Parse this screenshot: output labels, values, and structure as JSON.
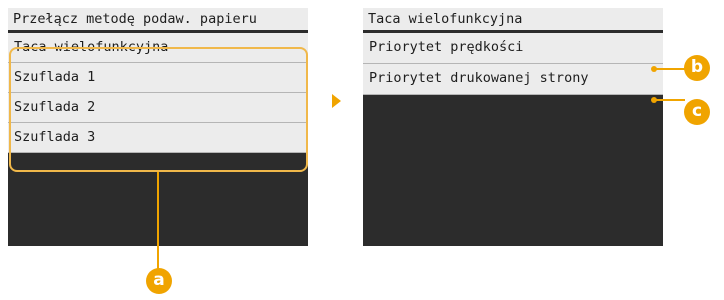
{
  "left_screen": {
    "title": "Przełącz metodę podaw. papieru",
    "items": [
      {
        "label": "Taca wielofunkcyjna"
      },
      {
        "label": "Szuflada 1"
      },
      {
        "label": "Szuflada 2"
      },
      {
        "label": "Szuflada 3"
      }
    ]
  },
  "right_screen": {
    "title": "Taca wielofunkcyjna",
    "items": [
      {
        "label": "Priorytet prędkości"
      },
      {
        "label": "Priorytet drukowanej strony"
      }
    ]
  },
  "callouts": {
    "a": "a",
    "b": "b",
    "c": "c"
  },
  "colors": {
    "accent": "#f0a400",
    "screen_bg": "#2c2c2c",
    "item_bg": "#ececec"
  }
}
